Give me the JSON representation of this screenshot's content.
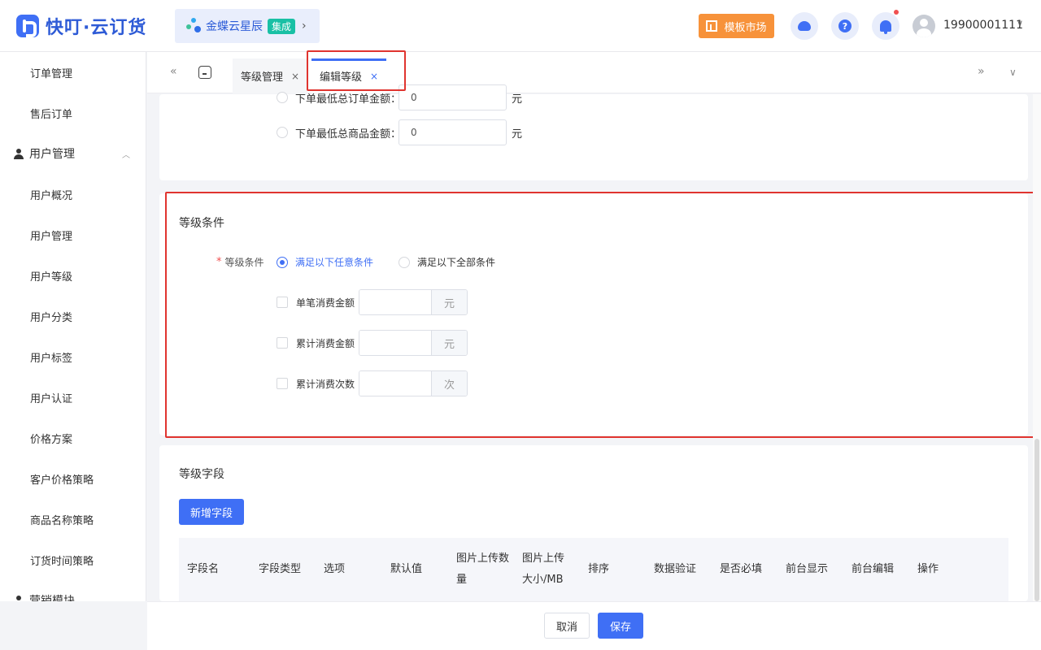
{
  "header": {
    "brand": "快叮·云订货",
    "kingdee_label": "金蝶云星辰",
    "kingdee_badge": "集成",
    "kingdee_chevron": "›",
    "template_market": "模板市场",
    "help_glyph": "?",
    "user_phone": "19900001111",
    "user_caret": "∨"
  },
  "sidebar": {
    "items": [
      {
        "label": "订单管理"
      },
      {
        "label": "售后订单"
      },
      {
        "label": "用户管理",
        "group": true
      },
      {
        "label": "用户概况"
      },
      {
        "label": "用户管理"
      },
      {
        "label": "用户等级"
      },
      {
        "label": "用户分类"
      },
      {
        "label": "用户标签"
      },
      {
        "label": "用户认证"
      },
      {
        "label": "价格方案"
      },
      {
        "label": "客户价格策略"
      },
      {
        "label": "商品名称策略"
      },
      {
        "label": "订货时间策略"
      },
      {
        "label": "营销模块",
        "group": true
      }
    ],
    "group_caret": "︿"
  },
  "tabs": {
    "prev": "«",
    "next": "»",
    "more": "∨",
    "close": "×",
    "items": [
      {
        "label": "等级管理"
      },
      {
        "label": "编辑等级"
      }
    ]
  },
  "order_limits": {
    "min_order_amount_label": "下单最低总订单金额：",
    "min_order_amount_value": "0",
    "min_goods_amount_label": "下单最低总商品金额：",
    "min_goods_amount_value": "0",
    "unit": "元"
  },
  "conditions": {
    "title": "等级条件",
    "required_mark": "*",
    "label": "等级条件",
    "option_any": "满足以下任意条件",
    "option_all": "满足以下全部条件",
    "items": [
      {
        "label": "单笔消费金额",
        "suffix": "元"
      },
      {
        "label": "累计消费金额",
        "suffix": "元"
      },
      {
        "label": "累计消费次数",
        "suffix": "次"
      }
    ]
  },
  "fields": {
    "title": "等级字段",
    "add_button": "新增字段",
    "columns": [
      "字段名",
      "字段类型",
      "选项",
      "默认值",
      "图片上传数量",
      "图片上传大小/MB",
      "排序",
      "数据验证",
      "是否必填",
      "前台显示",
      "前台编辑",
      "操作"
    ]
  },
  "footer": {
    "cancel": "取消",
    "save": "保存"
  }
}
